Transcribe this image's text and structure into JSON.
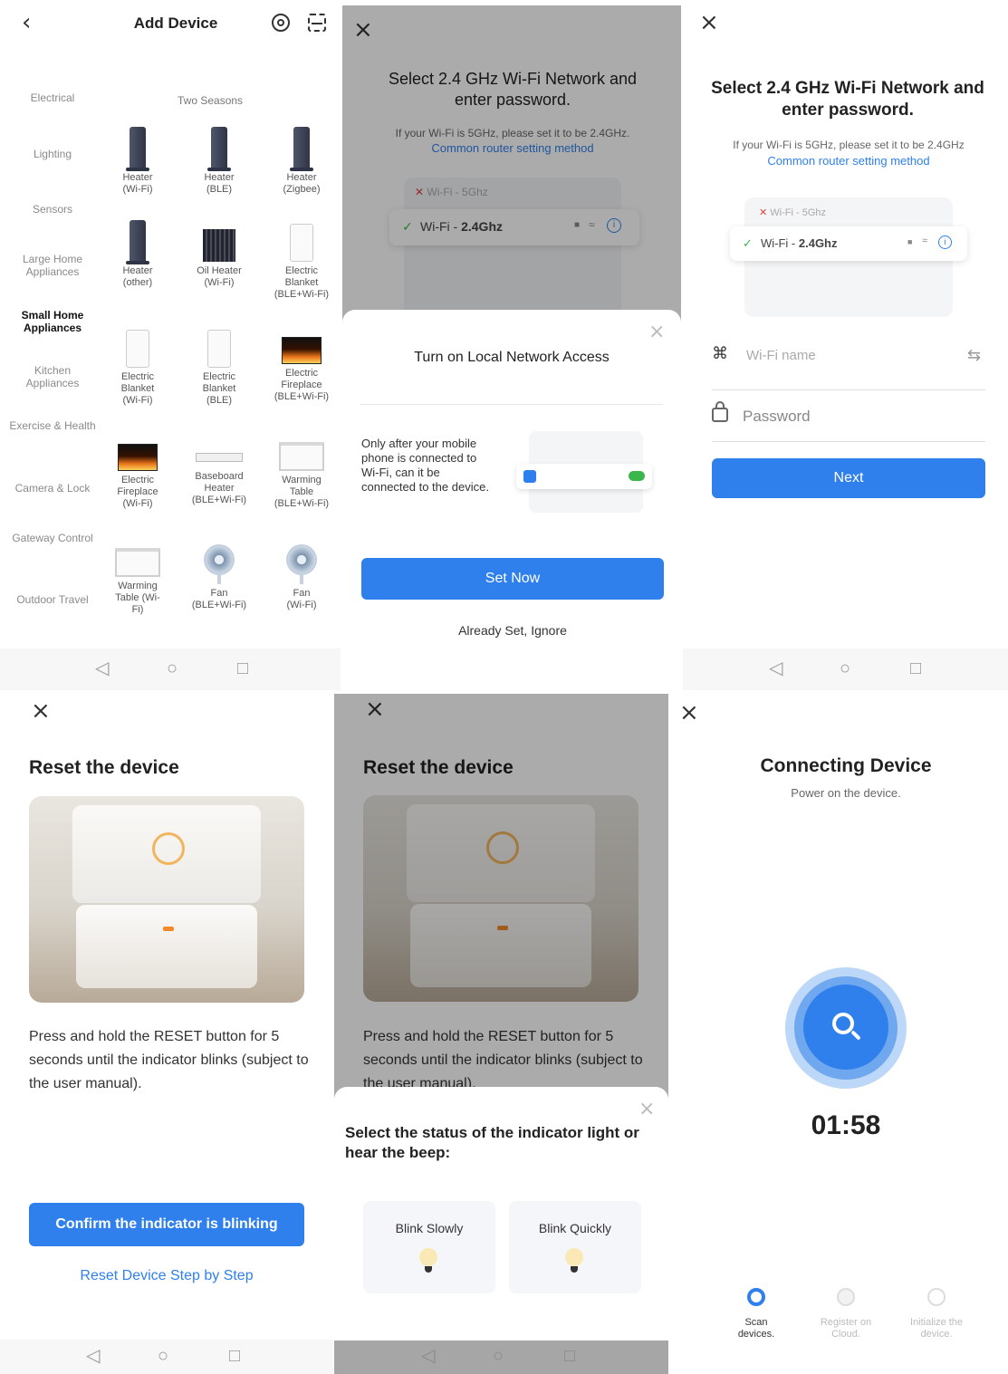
{
  "add_device": {
    "title": "Add Device",
    "back_icon": "back-arrow-icon",
    "categories": [
      "Electrical",
      "Lighting",
      "Sensors",
      "Large Home Appliances",
      "Small Home Appliances",
      "Kitchen Appliances",
      "Exercise & Health",
      "Camera & Lock",
      "Gateway Control",
      "Outdoor Travel"
    ],
    "section_title": "Two Seasons",
    "devices": [
      {
        "label": "Heater (Wi-Fi)",
        "icon": "tower-heater"
      },
      {
        "label": "Heater (BLE)",
        "icon": "tower-heater"
      },
      {
        "label": "Heater (Zigbee)",
        "icon": "tower-heater"
      },
      {
        "label": "Heater (other)",
        "icon": "tower-heater"
      },
      {
        "label": "Oil Heater (Wi-Fi)",
        "icon": "oil-heater"
      },
      {
        "label": "Electric Blanket (BLE+Wi-Fi)",
        "icon": "blanket"
      },
      {
        "label": "Electric Blanket (Wi-Fi)",
        "icon": "blanket"
      },
      {
        "label": "Electric Blanket (BLE)",
        "icon": "blanket"
      },
      {
        "label": "Electric Fireplace (BLE+Wi-Fi)",
        "icon": "fireplace"
      },
      {
        "label": "Electric Fireplace (Wi-Fi)",
        "icon": "fireplace"
      },
      {
        "label": "Baseboard Heater (BLE+Wi-Fi)",
        "icon": "baseboard"
      },
      {
        "label": "Warming Table (BLE+Wi-Fi)",
        "icon": "table"
      },
      {
        "label": "Warming Table (Wi-Fi)",
        "icon": "table"
      },
      {
        "label": "Fan (BLE+Wi-Fi)",
        "icon": "fan"
      },
      {
        "label": "Fan (Wi-Fi)",
        "icon": "fan"
      }
    ]
  },
  "wifi_common": {
    "title": "Select 2.4 GHz Wi-Fi Network and enter password.",
    "hint": "If your Wi-Fi is 5GHz, please set it to be 2.4GHz.",
    "hint_b": "If your Wi-Fi is 5GHz, please set it to be 2.4GHz",
    "link": "Common router setting method",
    "net_5g": "Wi-Fi - 5Ghz",
    "net_24_prefix": "Wi-Fi - ",
    "net_24_bold": "2.4Ghz"
  },
  "local_access": {
    "title": "Turn on Local Network Access",
    "body": "Only after your mobile phone is connected to Wi-Fi, can it be connected to the device.",
    "set_now": "Set Now",
    "ignore": "Already Set, Ignore"
  },
  "wifi_form": {
    "wifi_placeholder": "Wi-Fi name",
    "password_placeholder": "Password",
    "next": "Next"
  },
  "reset": {
    "title": "Reset the device",
    "body": "Press and hold the RESET button for 5 seconds until the indicator blinks (subject to the user manual).",
    "confirm": "Confirm the indicator is blinking",
    "stepbystep": "Reset Device Step by Step"
  },
  "indicator_sheet": {
    "title": "Select the status of the indicator light or hear the beep:",
    "slow": "Blink Slowly",
    "quick": "Blink Quickly"
  },
  "connecting": {
    "title": "Connecting Device",
    "subtitle": "Power on the device.",
    "timer": "01:58",
    "steps": [
      "Scan devices.",
      "Register on Cloud.",
      "Initialize the device."
    ]
  },
  "colors": {
    "accent": "#2f80ed",
    "green": "#3bb64b",
    "red": "#e04040"
  }
}
